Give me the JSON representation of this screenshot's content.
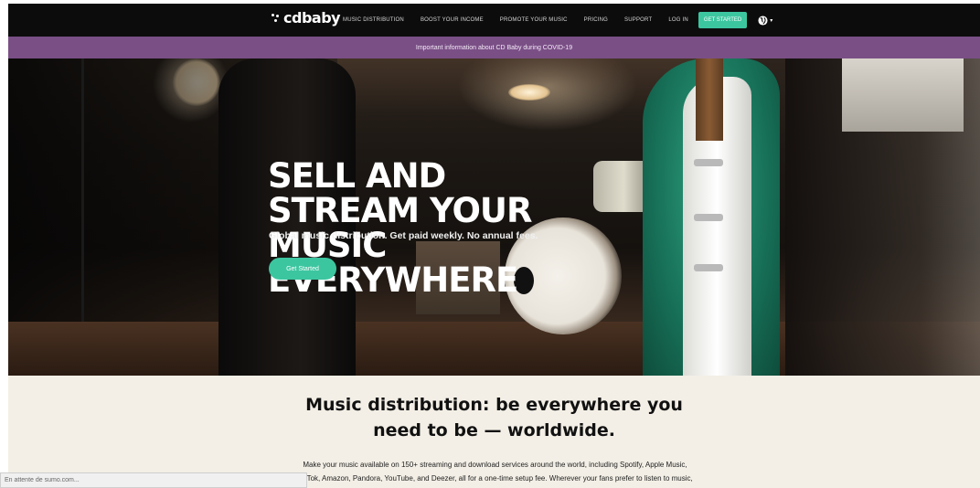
{
  "nav": {
    "logo": "cdbaby",
    "links": [
      "MUSIC DISTRIBUTION",
      "BOOST YOUR INCOME",
      "PROMOTE YOUR MUSIC",
      "PRICING",
      "SUPPORT",
      "LOG IN"
    ],
    "cta": "GET STARTED",
    "language_icon": "globe-icon"
  },
  "banner": {
    "text": "Important information about CD Baby during COVID-19"
  },
  "hero": {
    "title_line1": "SELL AND STREAM YOUR",
    "title_line2": "MUSIC EVERYWHERE",
    "subtitle": "Global music distribution. Get paid weekly. No annual fees.",
    "button": "Get Started"
  },
  "content": {
    "headline_line1": "Music distribution: be everywhere you",
    "headline_line2": "need to be — worldwide.",
    "body": "Make your music available on 150+ streaming and download services around the world, including Spotify, Apple Music, TikTok, Amazon, Pandora, YouTube, and Deezer, all for a one-time setup fee. Wherever your fans prefer to listen to music, they'll find you!"
  },
  "status_bar": {
    "text": "En attente de sumo.com..."
  },
  "colors": {
    "accent": "#3cc6a0",
    "banner": "#7a4f86",
    "nav": "#0c0c0d",
    "content_bg": "#f3efe6"
  }
}
